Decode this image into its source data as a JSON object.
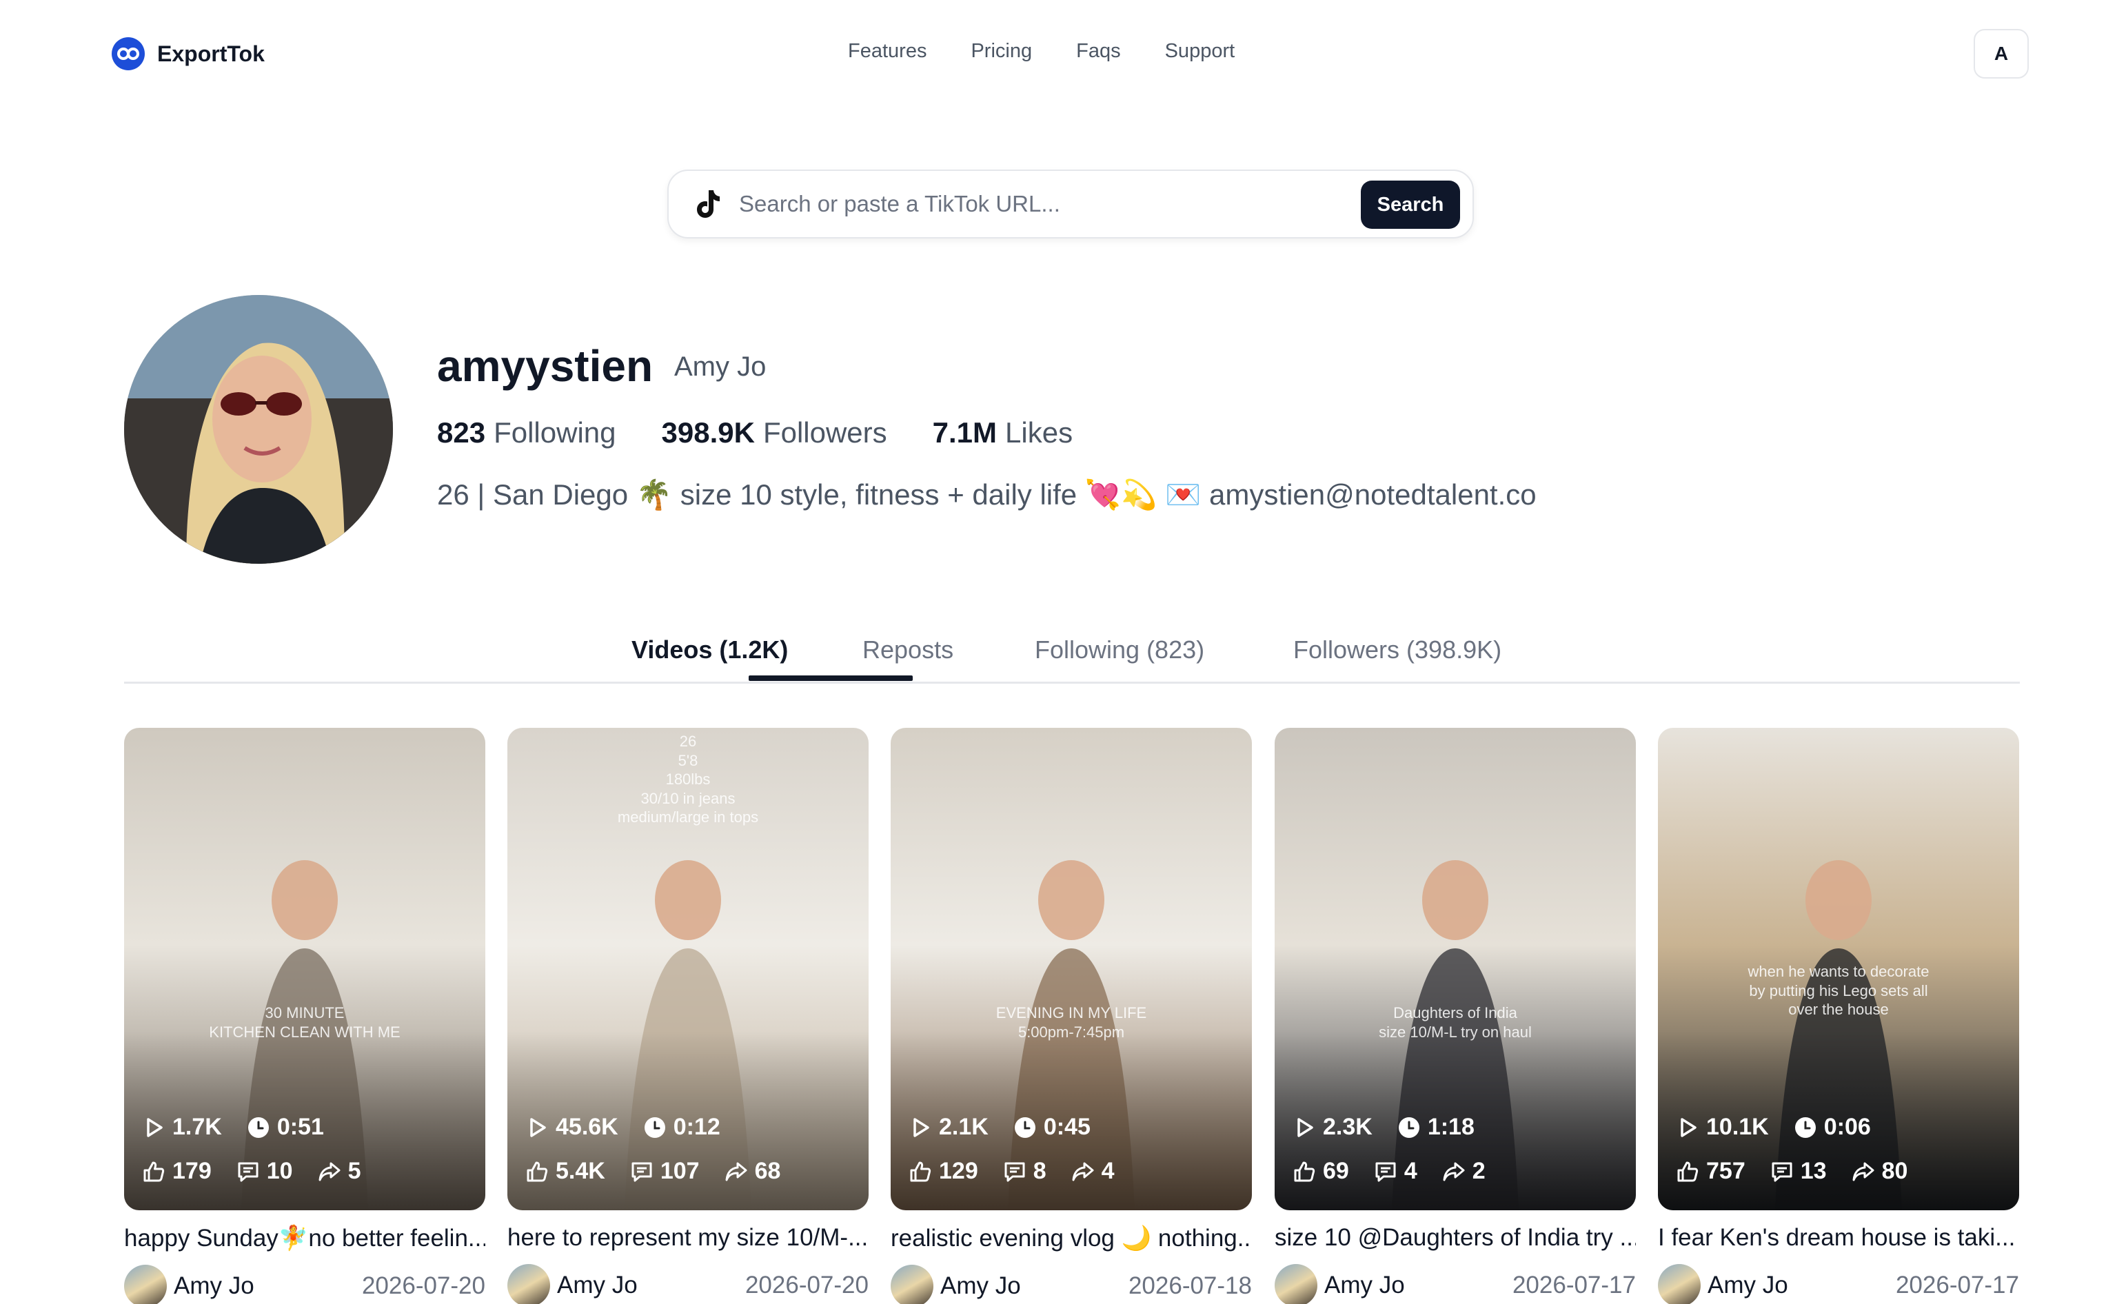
{
  "app": {
    "name": "ExportTok",
    "account_initial": "A"
  },
  "nav": [
    {
      "label": "Features"
    },
    {
      "label": "Pricing"
    },
    {
      "label": "Faqs"
    },
    {
      "label": "Support"
    }
  ],
  "search": {
    "placeholder": "Search or paste a TikTok URL...",
    "value": "",
    "button_label": "Search"
  },
  "profile": {
    "username": "amyystien",
    "display_name": "Amy Jo",
    "following_count": "823",
    "following_label": "Following",
    "followers_count": "398.9K",
    "followers_label": "Followers",
    "likes_count": "7.1M",
    "likes_label": "Likes",
    "bio": "26 | San Diego 🌴 size 10 style, fitness + daily life 💘💫 💌 amystien@notedtalent.co"
  },
  "tabs": [
    {
      "label": "Videos (1.2K)",
      "active": true
    },
    {
      "label": "Reposts",
      "active": false
    },
    {
      "label": "Following (823)",
      "active": false
    },
    {
      "label": "Followers (398.9K)",
      "active": false
    }
  ],
  "videos": [
    {
      "views": "1.7K",
      "duration": "0:51",
      "likes": "179",
      "comments": "10",
      "shares": "5",
      "overlay_text": "30 MINUTE\nKITCHEN CLEAN WITH ME",
      "title": "happy Sunday🧚no better feelin...",
      "author": "Amy Jo",
      "date": "2026-07-20",
      "colors": [
        "#cfc9bf",
        "#e8e4dc",
        "#7b6f62"
      ]
    },
    {
      "views": "45.6K",
      "duration": "0:12",
      "likes": "5.4K",
      "comments": "107",
      "shares": "68",
      "overlay_text": "26\n5'8\n180lbs\n30/10 in jeans\nmedium/large in tops",
      "title": "here to represent my size 10/M-...",
      "author": "Amy Jo",
      "date": "2026-07-20",
      "colors": [
        "#d9d4cc",
        "#efece6",
        "#b9a994"
      ]
    },
    {
      "views": "2.1K",
      "duration": "0:45",
      "likes": "129",
      "comments": "8",
      "shares": "4",
      "overlay_text": "EVENING IN MY LIFE\n5:00pm-7:45pm",
      "title": "realistic evening vlog 🌙 nothing...",
      "author": "Amy Jo",
      "date": "2026-07-18",
      "colors": [
        "#d6d0c6",
        "#eeebe5",
        "#8a6f56"
      ]
    },
    {
      "views": "2.3K",
      "duration": "1:18",
      "likes": "69",
      "comments": "4",
      "shares": "2",
      "overlay_text": "Daughters of India\nsize 10/M-L try on haul",
      "title": "size 10 @Daughters of India try ...",
      "author": "Amy Jo",
      "date": "2026-07-17",
      "colors": [
        "#cbc6be",
        "#e6e1d8",
        "#2d2e33"
      ]
    },
    {
      "views": "10.1K",
      "duration": "0:06",
      "likes": "757",
      "comments": "13",
      "shares": "80",
      "overlay_text": "when he wants to decorate\nby putting his Lego sets all\nover the house",
      "title": "I fear Ken's dream house is taki...",
      "author": "Amy Jo",
      "date": "2026-07-17",
      "colors": [
        "#e7e3dc",
        "#c9b392",
        "#1f2226"
      ]
    }
  ]
}
